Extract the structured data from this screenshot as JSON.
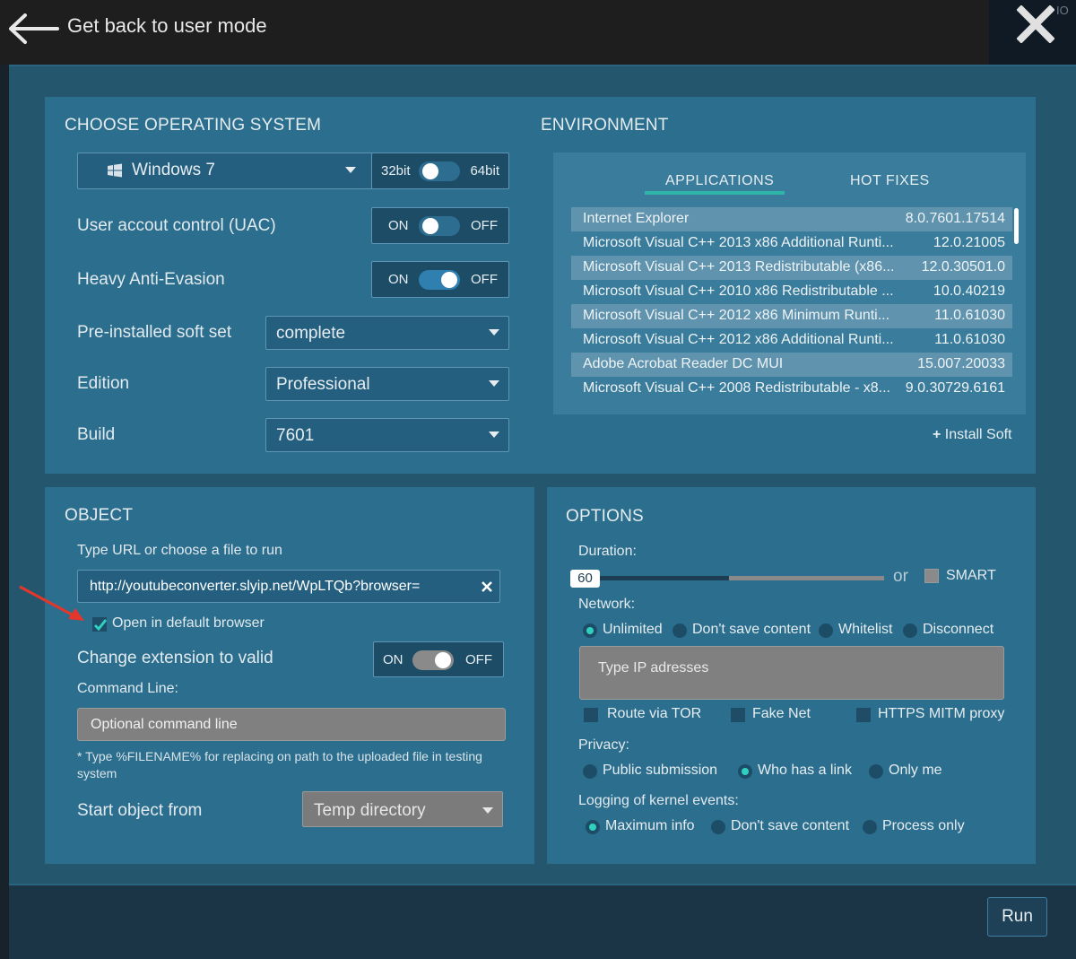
{
  "header": {
    "back_label": "Get back to user mode",
    "bg_right_label": "IO"
  },
  "os": {
    "title": "CHOOSE OPERATING SYSTEM",
    "selected_os": "Windows 7",
    "bit_left": "32bit",
    "bit_right": "64bit",
    "uac_label": "User accout control (UAC)",
    "uac_on": "ON",
    "uac_off": "OFF",
    "anti_label": "Heavy Anti-Evasion",
    "anti_on": "ON",
    "anti_off": "OFF",
    "softset_label": "Pre-installed soft set",
    "softset_value": "complete",
    "edition_label": "Edition",
    "edition_value": "Professional",
    "build_label": "Build",
    "build_value": "7601"
  },
  "environment": {
    "title": "ENVIRONMENT",
    "tabs": [
      "APPLICATIONS",
      "HOT FIXES"
    ],
    "applications": [
      {
        "name": "Internet Explorer",
        "version": "8.0.7601.17514"
      },
      {
        "name": "Microsoft Visual C++ 2013 x86 Additional Runti...",
        "version": "12.0.21005"
      },
      {
        "name": "Microsoft Visual C++ 2013 Redistributable (x86...",
        "version": "12.0.30501.0"
      },
      {
        "name": "Microsoft Visual C++ 2010 x86 Redistributable ...",
        "version": "10.0.40219"
      },
      {
        "name": "Microsoft Visual C++ 2012 x86 Minimum Runti...",
        "version": "11.0.61030"
      },
      {
        "name": "Microsoft Visual C++ 2012 x86 Additional Runti...",
        "version": "11.0.61030"
      },
      {
        "name": "Adobe Acrobat Reader DC MUI",
        "version": "15.007.20033"
      },
      {
        "name": "Microsoft Visual C++ 2008 Redistributable - x8...",
        "version": "9.0.30729.6161"
      }
    ],
    "install_soft": "Install Soft"
  },
  "object": {
    "title": "OBJECT",
    "url_label": "Type URL or choose a file to run",
    "url_value": "http://youtubeconverter.slyip.net/WpLTQb?browser=",
    "open_browser_label": "Open in default browser",
    "change_ext_label": "Change extension to valid",
    "change_ext_on": "ON",
    "change_ext_off": "OFF",
    "cmd_label": "Command Line:",
    "cmd_placeholder": "Optional command line",
    "note": "* Type %FILENAME% for replacing on path to the uploaded file in testing system",
    "start_from_label": "Start object from",
    "start_from_value": "Temp directory"
  },
  "options": {
    "title": "OPTIONS",
    "duration_label": "Duration:",
    "duration_value": "60",
    "duration_fraction": 0.5,
    "or_label": "or",
    "smart_label": "SMART",
    "network_label": "Network:",
    "network_options": [
      "Unlimited",
      "Don't save content",
      "Whitelist",
      "Disconnect"
    ],
    "network_selected": "Unlimited",
    "ip_placeholder": "Type IP adresses",
    "checks": [
      "Route via TOR",
      "Fake Net",
      "HTTPS MITM proxy"
    ],
    "privacy_label": "Privacy:",
    "privacy_options": [
      "Public submission",
      "Who has a link",
      "Only me"
    ],
    "privacy_selected": "Who has a link",
    "logging_label": "Logging of kernel events:",
    "logging_options": [
      "Maximum info",
      "Don't save content",
      "Process only"
    ],
    "logging_selected": "Maximum info"
  },
  "footer": {
    "run_label": "Run"
  }
}
